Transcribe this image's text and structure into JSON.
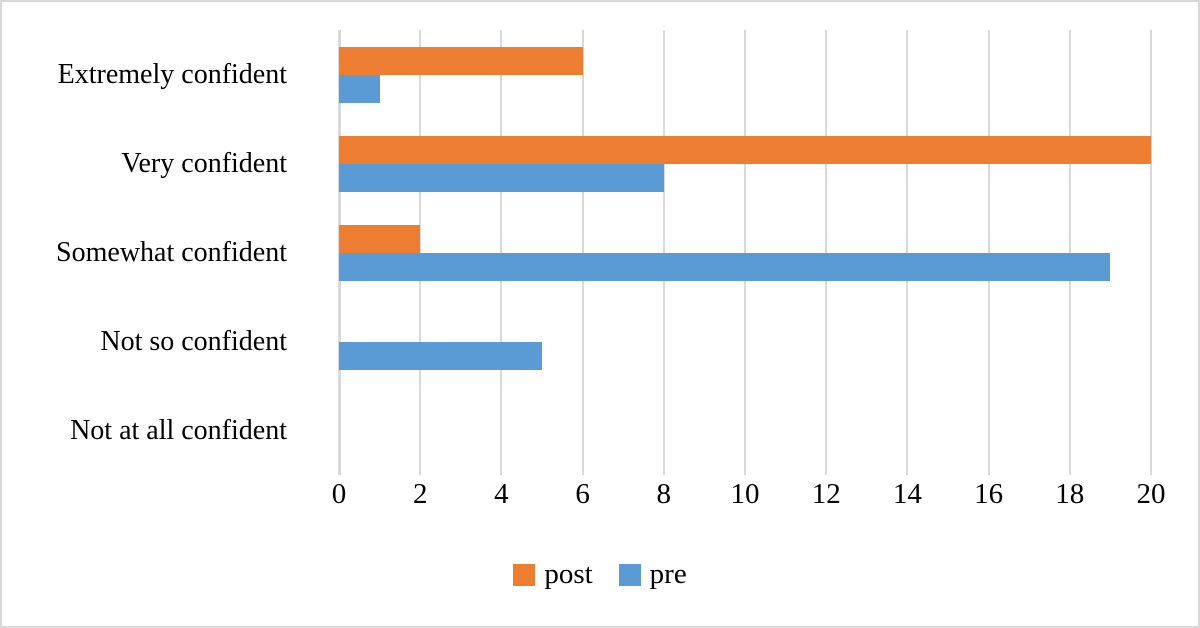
{
  "chart_data": {
    "type": "bar",
    "orientation": "horizontal",
    "title": "",
    "xlabel": "",
    "ylabel": "",
    "xlim": [
      0,
      20
    ],
    "xticks": [
      0,
      2,
      4,
      6,
      8,
      10,
      12,
      14,
      16,
      18,
      20
    ],
    "grid": true,
    "legend_position": "bottom",
    "categories": [
      "Extremely confident",
      "Very confident",
      "Somewhat confident",
      "Not so confident",
      "Not at all confident"
    ],
    "series": [
      {
        "name": "post",
        "color": "#ED7D31",
        "values": [
          6,
          20,
          2,
          0,
          0
        ]
      },
      {
        "name": "pre",
        "color": "#5B9BD5",
        "values": [
          1,
          8,
          19,
          5,
          0
        ]
      }
    ]
  },
  "legend": {
    "items": [
      {
        "label": "post",
        "color": "#ED7D31"
      },
      {
        "label": "pre",
        "color": "#5B9BD5"
      }
    ]
  },
  "colors": {
    "post": "#ED7D31",
    "pre": "#5B9BD5",
    "gridline": "#d9d9d9",
    "border": "#d9d9d9",
    "text": "#000000",
    "background": "#ffffff"
  }
}
